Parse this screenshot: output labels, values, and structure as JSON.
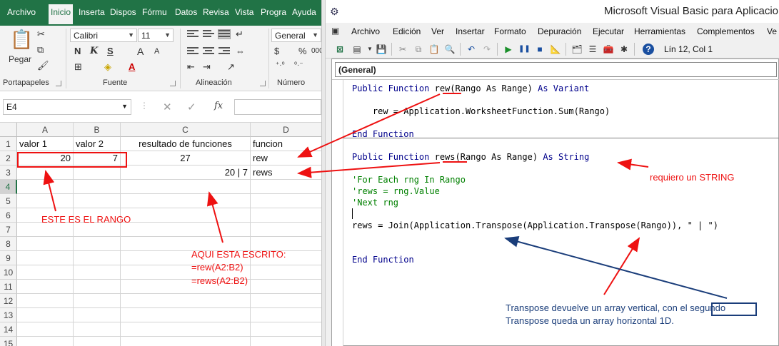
{
  "excel": {
    "tabs": [
      "Archivo",
      "Inicio",
      "Inserta",
      "Dispos",
      "Fórmu",
      "Datos",
      "Revisa",
      "Vista",
      "Progra",
      "Ayuda"
    ],
    "ribbon": {
      "clipboard": {
        "paste_label": "Pegar",
        "group_label": "Portapapeles"
      },
      "font": {
        "font_name": "Calibri",
        "font_size": "11",
        "bold": "N",
        "italic": "K",
        "underline": "S",
        "grow": "A",
        "shrink": "A",
        "group_label": "Fuente"
      },
      "alignment": {
        "group_label": "Alineación"
      },
      "number": {
        "format": "General",
        "percent": "%",
        "thousands": "000",
        "group_label": "Número"
      }
    },
    "name_box": "E4",
    "formula_icons": {
      "cancel": "✕",
      "confirm": "✓",
      "fx": "fx"
    },
    "columns": [
      "A",
      "B",
      "C",
      "D"
    ],
    "rows": [
      {
        "n": "1",
        "A": "valor 1",
        "B": "valor 2",
        "C": "resultado de funciones",
        "D": "funcion"
      },
      {
        "n": "2",
        "A": "20",
        "B": "7",
        "C": "27",
        "D": "rew"
      },
      {
        "n": "3",
        "A": "",
        "B": "",
        "C": "20 | 7",
        "D": "rews"
      },
      {
        "n": "4"
      },
      {
        "n": "5"
      },
      {
        "n": "6"
      },
      {
        "n": "7"
      },
      {
        "n": "8"
      },
      {
        "n": "9"
      },
      {
        "n": "10"
      },
      {
        "n": "11"
      },
      {
        "n": "12"
      },
      {
        "n": "13"
      },
      {
        "n": "14"
      },
      {
        "n": "15"
      }
    ],
    "annotations": {
      "range_label": "ESTE ES EL RANGO",
      "written_1": "AQUI ESTA ESCRITO:",
      "written_2": "=rew(A2:B2)",
      "written_3": "=rews(A2:B2)"
    }
  },
  "vbe": {
    "title": "Microsoft Visual Basic para Aplicaciones",
    "menu": [
      "Archivo",
      "Edición",
      "Ver",
      "Insertar",
      "Formato",
      "Depuración",
      "Ejecutar",
      "Herramientas",
      "Complementos",
      "Ve"
    ],
    "position": "Lín 12, Col 1",
    "object_combo": "(General)",
    "code": {
      "l1_kw1": "Public Function ",
      "l1_name": "rew",
      "l1_rest": "(Rango As Range) ",
      "l1_kw2": "As Variant",
      "l2": "    rew = Application.WorksheetFunction.Sum(Rango)",
      "l3": "End Function",
      "l4_kw1": "Public Function ",
      "l4_name": "rews",
      "l4_rest": "(Rango As Range) ",
      "l4_kw2": "As String",
      "c1": "'For Each rng In Rango",
      "c2": "'rews = rng.Value",
      "c3": "'Next rng",
      "l5": "rews = Join(Application.Transpose(Application.Transpose(Rango)), \" | \")",
      "l6": "End Function"
    },
    "annotations": {
      "string_note": "requiero un STRING",
      "transpose_1": "Transpose devuelve un array vertical, con el segundo",
      "transpose_2": "Transpose queda un array horizontal 1D."
    }
  },
  "colors": {
    "excel_green": "#217346",
    "annotation_red": "#e11111",
    "annotation_blue": "#1a3d7a"
  }
}
